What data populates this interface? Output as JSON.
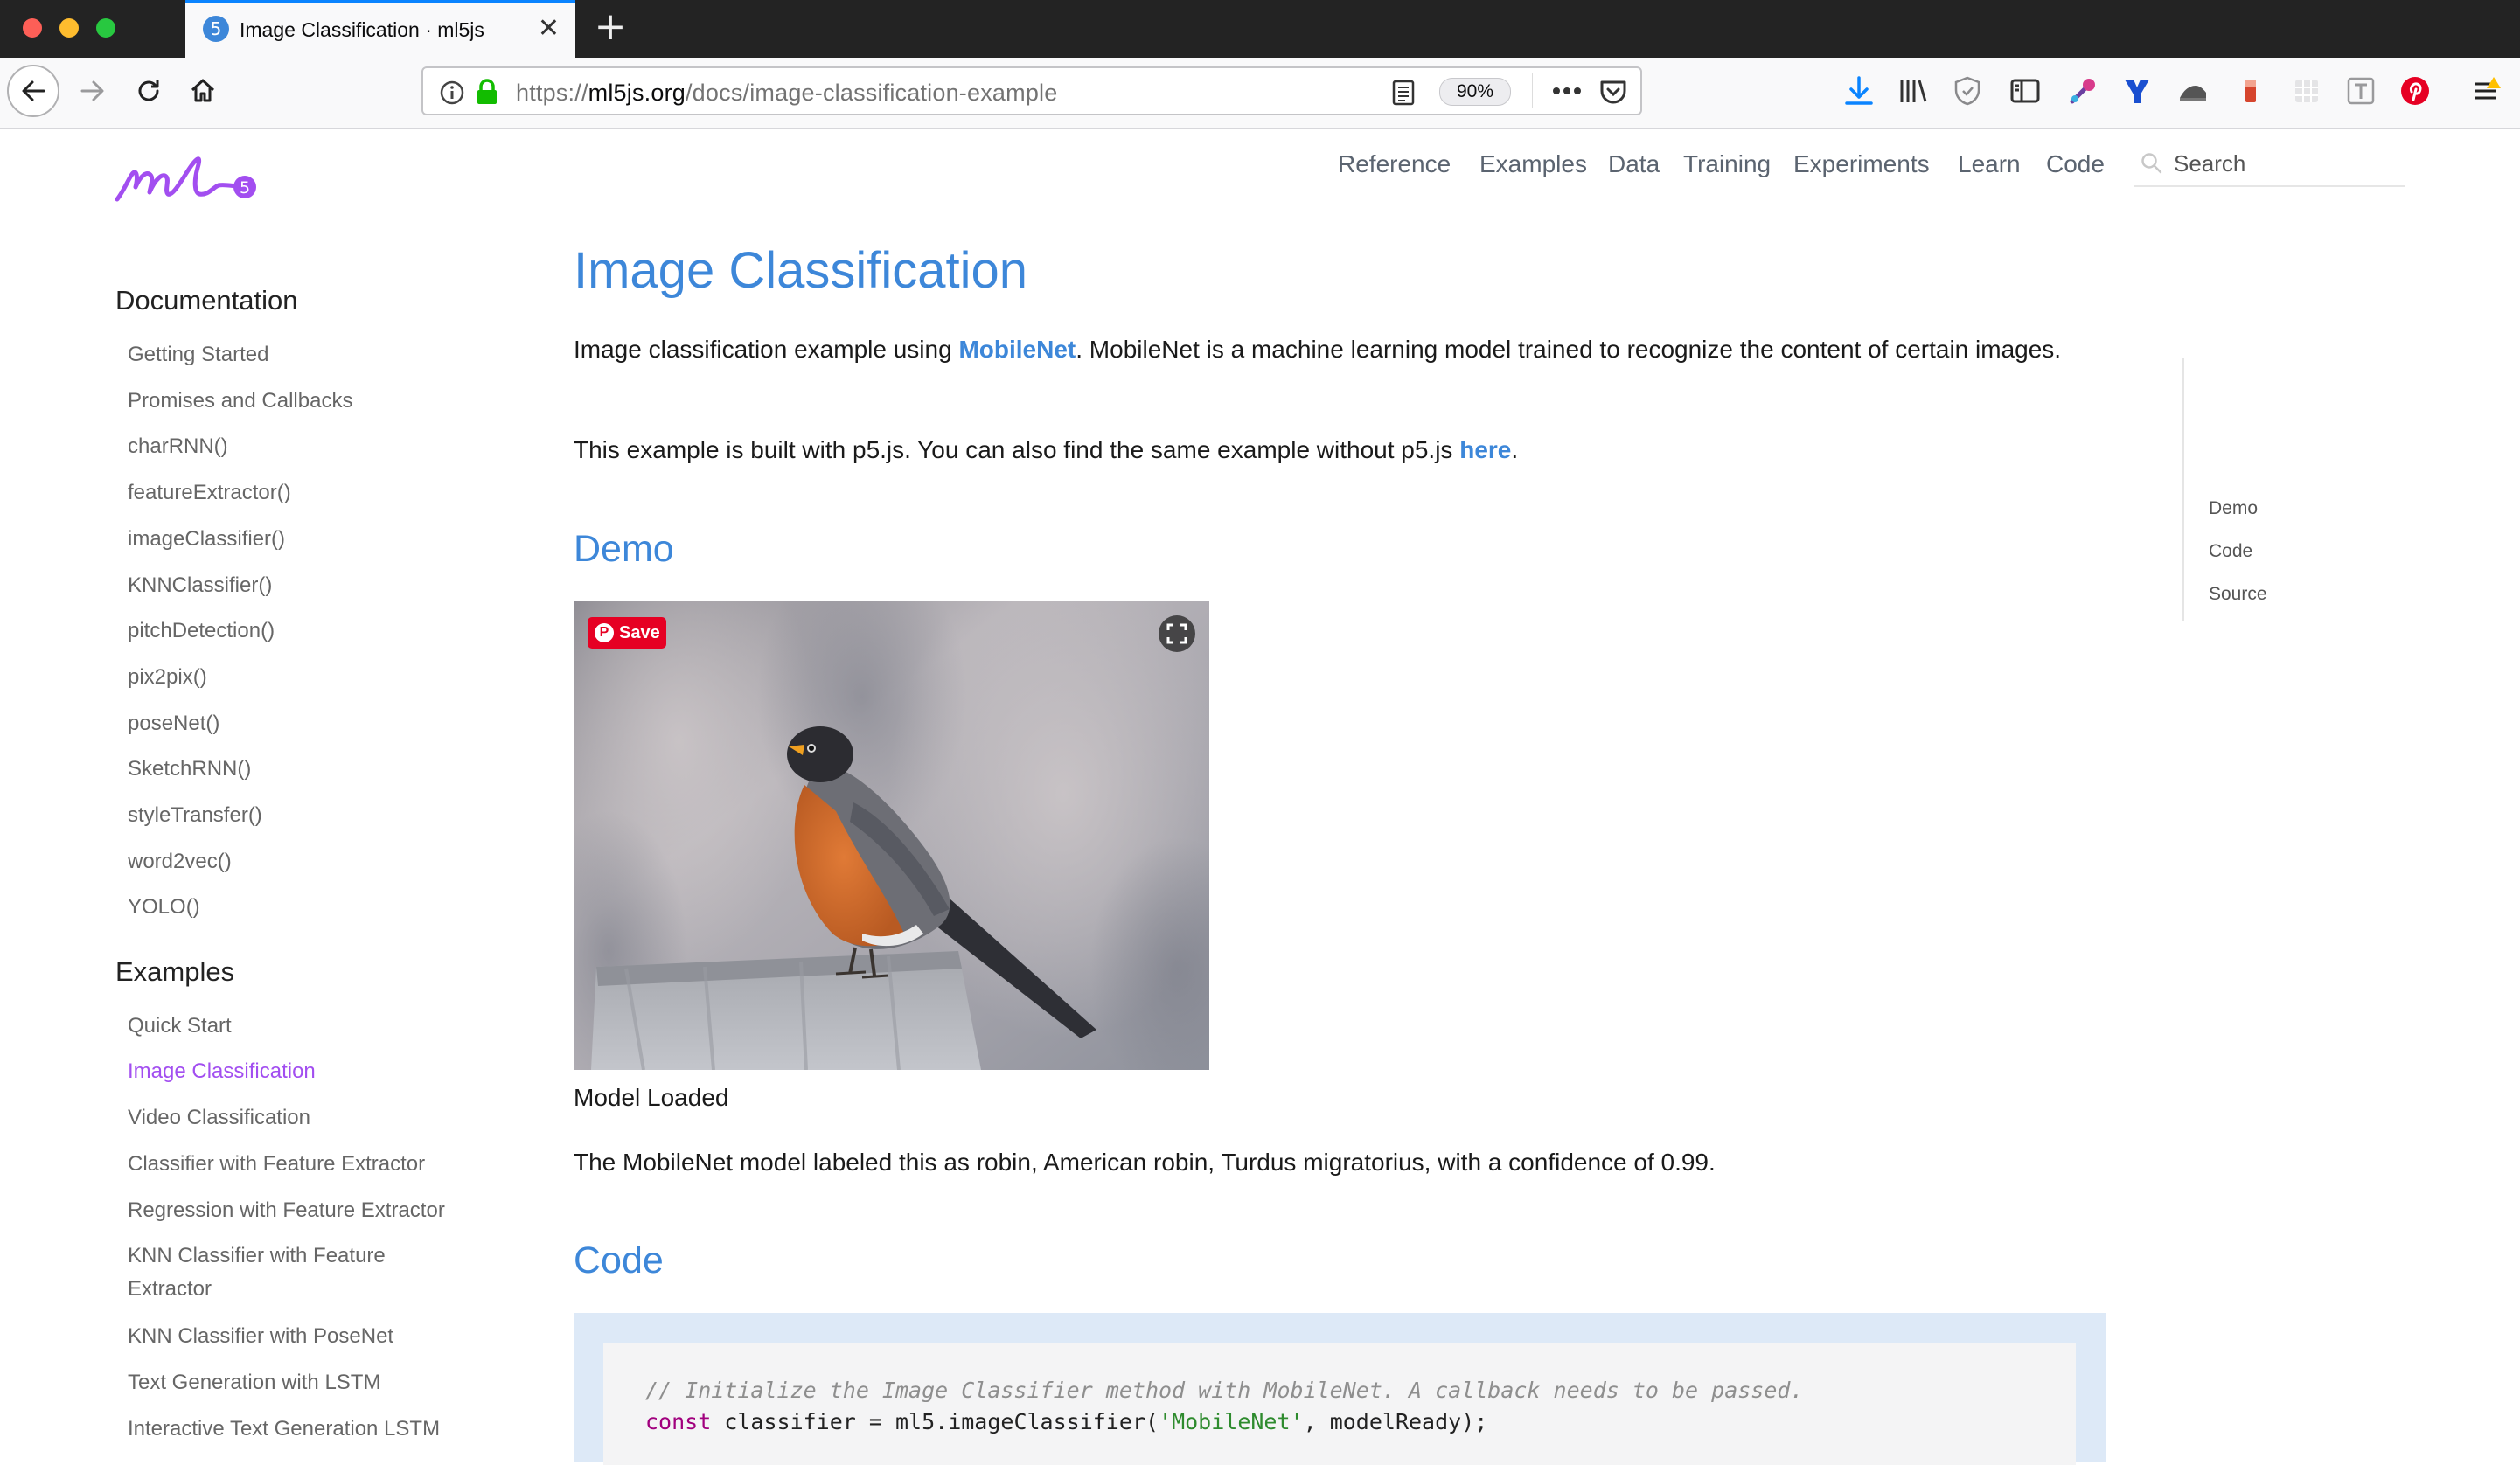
{
  "browser": {
    "tab_title": "Image Classification · ml5js",
    "tab_favicon_text": "5",
    "tab_close": "✕",
    "new_tab": "+",
    "url_prefix": "https://",
    "url_domain": "ml5js.org",
    "url_path": "/docs/image-classification-example",
    "zoom": "90%",
    "accent_color": "#0a84ff"
  },
  "site": {
    "logo_text": "ml5",
    "nav": [
      "Reference",
      "Examples",
      "Data",
      "Training",
      "Experiments",
      "Learn",
      "Code"
    ],
    "search_placeholder": "Search",
    "link_color": "#3d87d9",
    "active_color": "#a24ef0"
  },
  "sidebar": {
    "documentation_heading": "Documentation",
    "documentation_items": [
      "Getting Started",
      "Promises and Callbacks",
      "charRNN()",
      "featureExtractor()",
      "imageClassifier()",
      "KNNClassifier()",
      "pitchDetection()",
      "pix2pix()",
      "poseNet()",
      "SketchRNN()",
      "styleTransfer()",
      "word2vec()",
      "YOLO()"
    ],
    "examples_heading": "Examples",
    "examples_items": [
      "Quick Start",
      "Image Classification",
      "Video Classification",
      "Classifier with Feature Extractor",
      "Regression with Feature Extractor",
      "KNN Classifier with Feature",
      "Extractor",
      "KNN Classifier with PoseNet",
      "Text Generation with LSTM",
      "Interactive Text Generation LSTM"
    ],
    "active_item": "Image Classification"
  },
  "main": {
    "title": "Image Classification",
    "intro_before": "Image classification example using ",
    "intro_link": "MobileNet",
    "intro_after": ". MobileNet is a machine learning model trained to recognize the content of certain images.",
    "p5_before": "This example is built with p5.js. You can also find the same example without p5.js ",
    "p5_link": "here",
    "p5_after": ".",
    "demo_heading": "Demo",
    "pin_save": "Save",
    "model_status": "Model Loaded",
    "result": "The MobileNet model labeled this as robin, American robin, Turdus migratorius, with a confidence of 0.99.",
    "code_heading": "Code",
    "code_comment": "// Initialize the Image Classifier method with MobileNet. A callback needs to be passed.",
    "code_kw": "const",
    "code_mid": " classifier = ml5.imageClassifier(",
    "code_str": "'MobileNet'",
    "code_end": ", modelReady);"
  },
  "toc": [
    "Demo",
    "Code",
    "Source"
  ]
}
